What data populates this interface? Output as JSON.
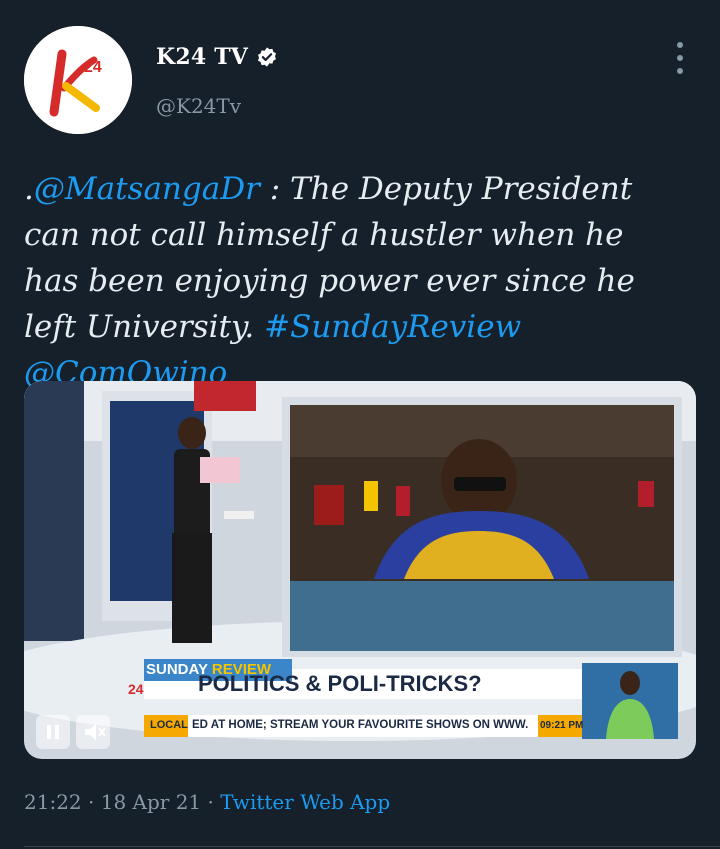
{
  "tweet": {
    "author": {
      "display_name": "K24 TV",
      "handle": "@K24Tv",
      "logo_text": "24",
      "verified": true
    },
    "text_prefix": ".",
    "mention1": "@MatsangaDr",
    "body": " : The Deputy President can not call himself a hustler when he has been enjoying power ever since he left University.",
    "hashtag": "#SundayReview",
    "mention2": "@ComOwino",
    "media": {
      "show_tag": "SUNDAY",
      "show_tag2": "REVIEW",
      "headline": "POLITICS & POLI-TRICKS?",
      "ticker_label": "LOCAL",
      "ticker_text": "ED AT HOME; STREAM YOUR FAVOURITE SHOWS ON WWW.",
      "ticker_time": "09:21 PM",
      "watermark": "24"
    },
    "time": "21:22",
    "separator": "·",
    "date": "18 Apr 21",
    "source": "Twitter Web App"
  },
  "colors": {
    "background": "#15202b",
    "link": "#1d9bf0",
    "secondary_text": "#8899a6",
    "brand_red": "#d62b2b",
    "brand_yellow": "#f5b800"
  }
}
